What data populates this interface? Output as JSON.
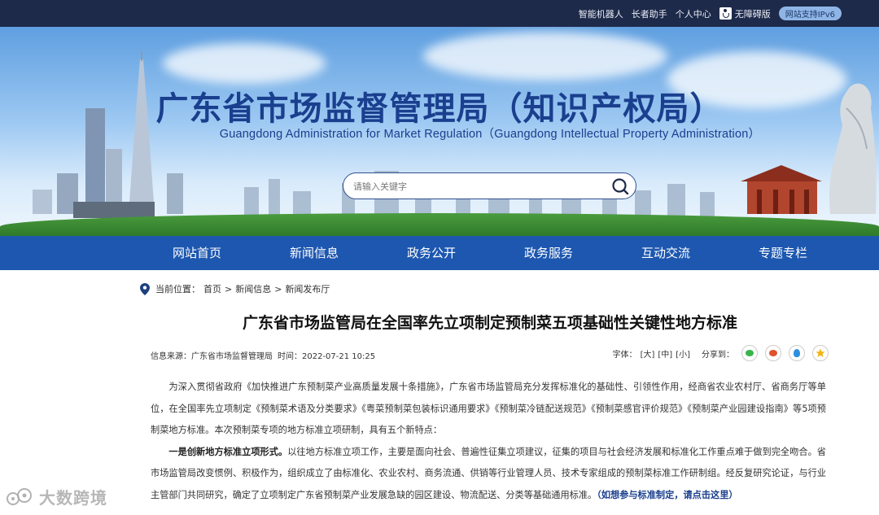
{
  "topbar": {
    "links": [
      "智能机器人",
      "长者助手",
      "个人中心"
    ],
    "accessibility": "无障碍版",
    "ipv6": "网站支持IPv6"
  },
  "banner": {
    "title": "广东省市场监督管理局（知识产权局）",
    "subtitle": "Guangdong Administration for Market Regulation（Guangdong Intellectual Property Administration）",
    "search_placeholder": "请输入关键字"
  },
  "nav": {
    "items": [
      "网站首页",
      "新闻信息",
      "政务公开",
      "政务服务",
      "互动交流",
      "专题专栏"
    ]
  },
  "breadcrumb": {
    "label": "当前位置：",
    "items": [
      "首页",
      "新闻信息",
      "新闻发布厅"
    ],
    "sep": ">"
  },
  "article": {
    "title": "广东省市场监管局在全国率先立项制定预制菜五项基础性关键性地方标准",
    "source": "信息来源：广东省市场监督管理局",
    "time": "时间：2022-07-21 10:25",
    "font_label": "字体：",
    "font_sizes": [
      "[大]",
      "[中]",
      "[小]"
    ],
    "share_label": "分享到：",
    "para1": "为深入贯彻省政府《加快推进广东预制菜产业高质量发展十条措施》，广东省市场监管局充分发挥标准化的基础性、引领性作用，经商省农业农村厅、省商务厅等单位，在全国率先立项制定《预制菜术语及分类要求》《粤菜预制菜包装标识通用要求》《预制菜冷链配送规范》《预制菜感官评价规范》《预制菜产业园建设指南》等5项预制菜地方标准。本次预制菜专项的地方标准立项研制，具有五个新特点：",
    "para2_bold": "一是创新地方标准立项形式。",
    "para2": "以往地方标准立项工作，主要是面向社会、普遍性征集立项建议，征集的项目与社会经济发展和标准化工作重点难于做到完全吻合。省市场监管局改变惯例、积极作为，组织成立了由标准化、农业农村、商务流通、供销等行业管理人员、技术专家组成的预制菜标准工作研制组。经反复研究论证，与行业主管部门共同研究，确定了立项制定广东省预制菜产业发展急缺的园区建设、物流配送、分类等基础通用标准。",
    "para2_link": "（如想参与标准制定，请点击这里）"
  },
  "watermark": "大数跨境",
  "colors": {
    "topbar": "#1e2a4a",
    "nav": "#1d57b0",
    "title_blue": "#1a3f8e"
  }
}
